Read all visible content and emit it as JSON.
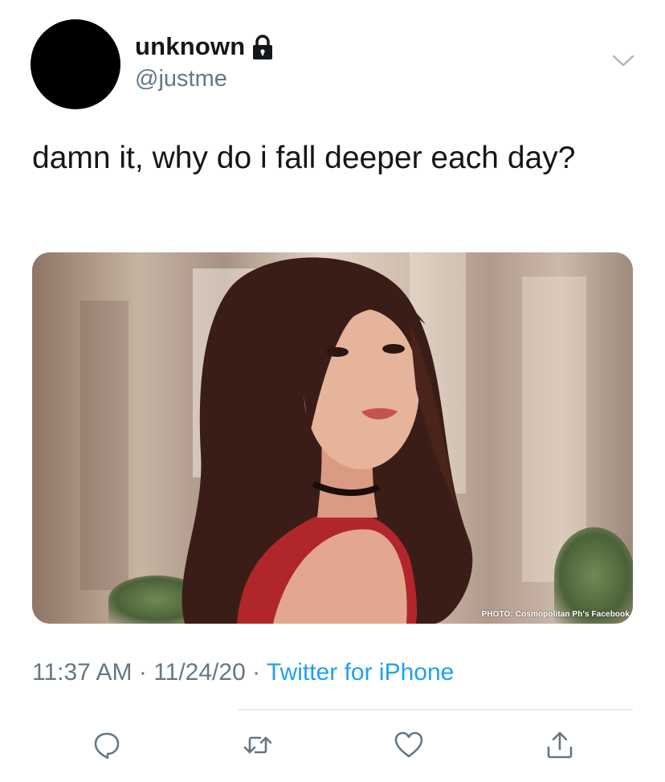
{
  "user": {
    "display_name": "unknown",
    "handle": "@justme",
    "protected_icon": "lock-icon"
  },
  "tweet": {
    "text": "damn it, why do i fall deeper each day?",
    "photo_credit": "PHOTO: Cosmopolitan Ph's Facebook"
  },
  "meta": {
    "time": "11:37 AM",
    "separator1": " · ",
    "date": "11/24/20",
    "separator2": " · ",
    "source": "Twitter for iPhone"
  },
  "actions": [
    {
      "name": "reply",
      "icon": "reply-icon"
    },
    {
      "name": "retweet",
      "icon": "retweet-icon"
    },
    {
      "name": "like",
      "icon": "heart-icon"
    },
    {
      "name": "share",
      "icon": "share-icon"
    }
  ],
  "colors": {
    "link": "#1da1f2",
    "secondary_text": "#657786",
    "primary_text": "#14171a",
    "icon": "#657786"
  }
}
